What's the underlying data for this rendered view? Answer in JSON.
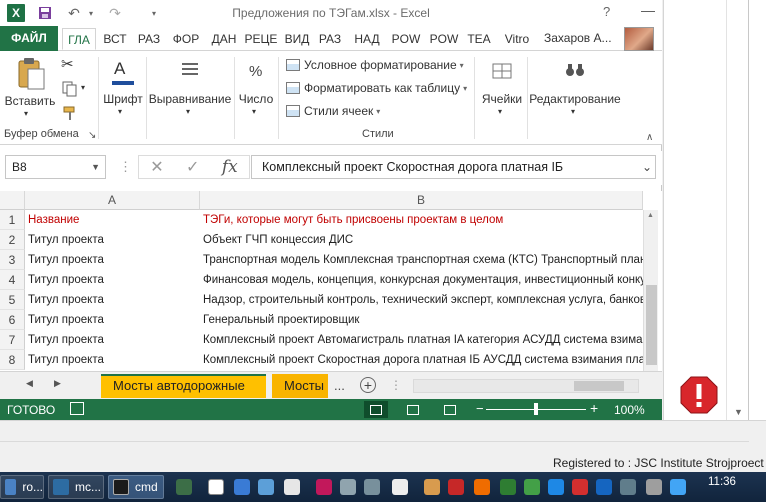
{
  "window": {
    "title": "Предложения по ТЭГам.xlsx - Excel",
    "help": "?",
    "min": "—"
  },
  "ribbon_tabs": [
    "ФАЙЛ",
    "ГЛА",
    "ВСТ",
    "РАЗ",
    "ФОР",
    "ДАН",
    "РЕЦЕ",
    "ВИД",
    "РАЗ",
    "НАД",
    "POW",
    "POW",
    "TEA",
    "Vitro"
  ],
  "user": {
    "name": "Захаров А..."
  },
  "ribbon": {
    "paste": "Вставить",
    "clipboard": "Буфер обмена",
    "font": "Шрифт",
    "alignment": "Выравнивание",
    "number": "Число",
    "number_sym": "%",
    "cond_format": "Условное форматирование",
    "format_table": "Форматировать как таблицу",
    "cell_styles": "Стили ячеек",
    "styles": "Стили",
    "cells": "Ячейки",
    "editing": "Редактирование"
  },
  "formula_bar": {
    "cell_ref": "B8",
    "fx": "fx",
    "content": "Комплексный проект Скоростная дорога  платная IБ"
  },
  "columns": [
    "A",
    "B"
  ],
  "rows": [
    {
      "n": "1",
      "a": "Название",
      "b": "ТЭГи, которые могут быть присвоены проектам в целом"
    },
    {
      "n": "2",
      "a": "Титул проекта",
      "b": "Объект ГЧП концессия ДИС"
    },
    {
      "n": "3",
      "a": "Титул проекта",
      "b": "Транспортная модель Комплексная транспортная схема (КТС) Транспортный план Ко"
    },
    {
      "n": "4",
      "a": "Титул проекта",
      "b": "Финансовая модель, концепция, конкурсная документация, инвестиционный конкурс,"
    },
    {
      "n": "5",
      "a": "Титул проекта",
      "b": "Надзор, строительный контроль, технический эксперт, комплексная услуга, банковск"
    },
    {
      "n": "6",
      "a": "Титул проекта",
      "b": "Генеральный проектировщик"
    },
    {
      "n": "7",
      "a": "Титул проекта",
      "b": "Комплексный проект Автомагистраль  платная IA категория АСУДД система взимани"
    },
    {
      "n": "8",
      "a": "Титул проекта",
      "b": "Комплексный проект Скоростная дорога  платная IБ АУСДД  система взимания плат"
    }
  ],
  "sheets": {
    "active": "Мосты автодорожные",
    "second": "Мосты",
    "more": "...",
    "add": "+"
  },
  "status": {
    "ready": "ГОТОВО",
    "zoom": "100%",
    "minus": "−",
    "plus": "+"
  },
  "registered": "Registered to : JSC Institute Strojproect",
  "taskbar": {
    "items": [
      "ro...",
      "mc...",
      "cmd"
    ],
    "clock": "11:36"
  }
}
